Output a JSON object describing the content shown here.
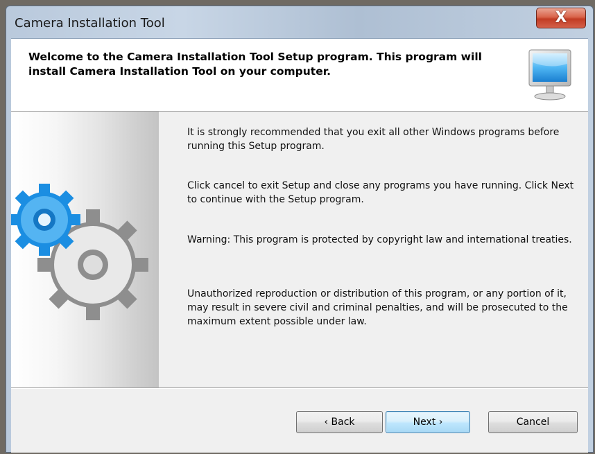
{
  "window": {
    "title": "Camera Installation Tool",
    "close_glyph": "X"
  },
  "header": {
    "text": "Welcome to the Camera Installation Tool Setup program. This program will install Camera Installation Tool on your computer.",
    "icon": "monitor-icon"
  },
  "sidebar": {
    "icon": "gears-icon"
  },
  "body": {
    "paragraphs": [
      "It is strongly recommended that you exit all other Windows programs before running this Setup program.",
      "Click cancel to exit Setup and close any programs you have running. Click Next to continue with the Setup program.",
      "Warning: This program is protected by copyright law and international treaties.",
      "Unauthorized reproduction or distribution of this program, or any portion of it, may result in severe civil and criminal penalties, and will be prosecuted to the maximum extent possible under law."
    ]
  },
  "buttons": {
    "back": "‹ Back",
    "next": "Next ›",
    "cancel": "Cancel"
  },
  "colors": {
    "accent_blue": "#1e8fe0",
    "gear_gray": "#8c8c8c",
    "close_red": "#c74a33"
  }
}
